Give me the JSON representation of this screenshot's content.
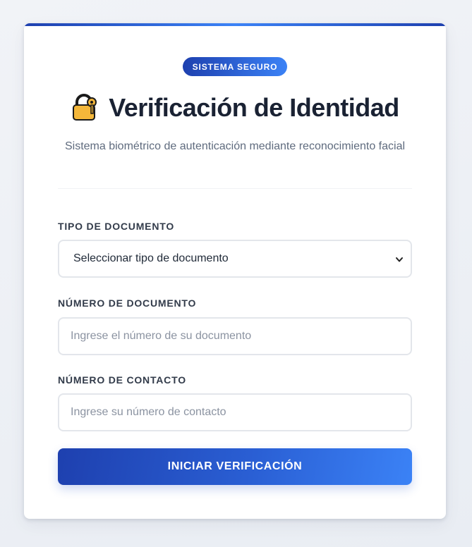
{
  "header": {
    "badge": "SISTEMA SEGURO",
    "title_icon": "lock-with-key-icon",
    "title": "Verificación de Identidad",
    "subtitle": "Sistema biométrico de autenticación mediante reconocimiento facial"
  },
  "form": {
    "document_type": {
      "label": "TIPO DE DOCUMENTO",
      "selected": "Seleccionar tipo de documento"
    },
    "document_number": {
      "label": "NÚMERO DE DOCUMENTO",
      "placeholder": "Ingrese el número de su documento"
    },
    "contact_number": {
      "label": "NÚMERO DE CONTACTO",
      "placeholder": "Ingrese su número de contacto"
    },
    "submit_label": "INICIAR VERIFICACIÓN"
  },
  "colors": {
    "accent_dark": "#1e40af",
    "accent_light": "#3b82f6",
    "title": "#1a2233",
    "muted": "#5f6b7e"
  }
}
